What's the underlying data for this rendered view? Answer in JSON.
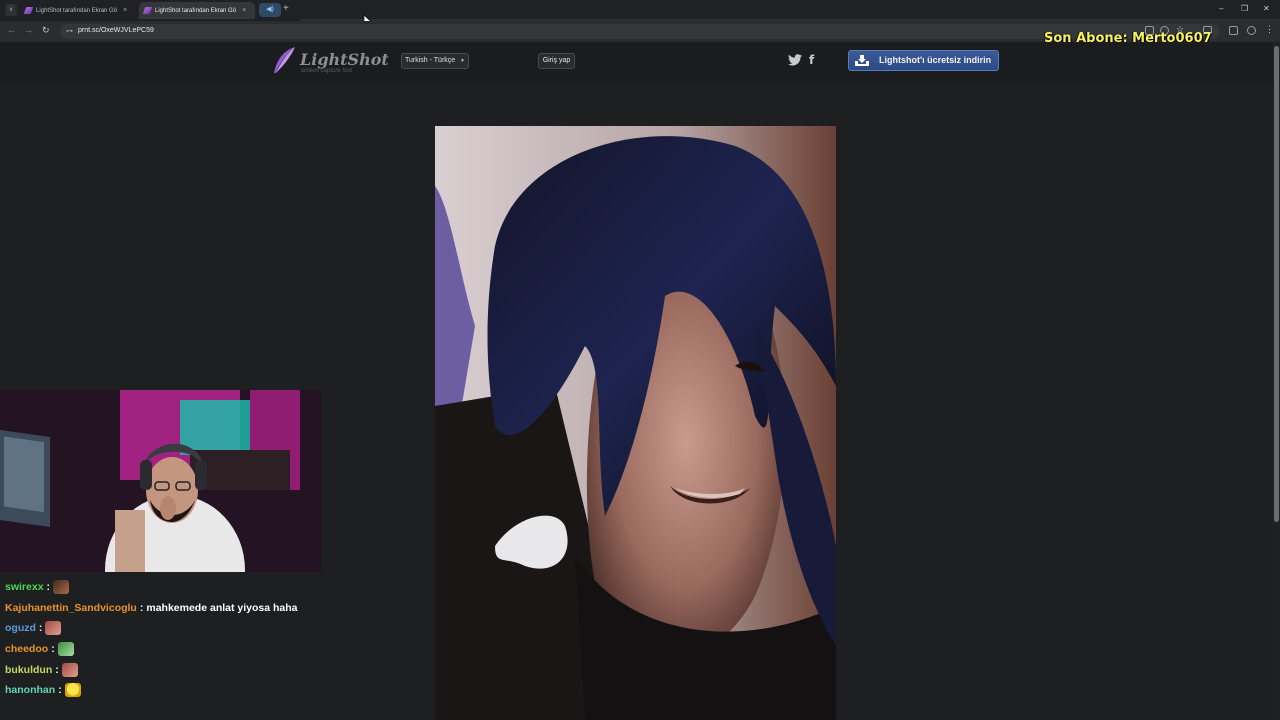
{
  "browser": {
    "tabs": [
      {
        "title": "LightShot tarafından Ekran Gö",
        "active": false
      },
      {
        "title": "LightShot tarafından Ekran Gö",
        "active": true
      }
    ],
    "tab_dropdown_icon": "v",
    "audio_tab_icon": "◀)",
    "new_tab_icon": "+",
    "close_icon": "×",
    "window_controls": {
      "minimize": "–",
      "restore": "❐",
      "close": "✕"
    },
    "back_icon": "←",
    "forward_icon": "→",
    "reload_icon": "↻",
    "site_info_icon": "⊶",
    "url": "prnt.sc/OxeWJVLePC59"
  },
  "stream_overlay": {
    "last_subscriber": "Son Abone: Merto0607",
    "color": "#f7f25c"
  },
  "lightshot": {
    "logo": "LightShot",
    "tagline": "screen capture tool",
    "language": "Turkish - Türkçe",
    "language_arrow": "▼",
    "login": "Giriş yap",
    "download": "Lightshot'ı ücretsiz indirin",
    "accent": "#2c4a86"
  },
  "chat": [
    {
      "user": "swirexx",
      "color": "#4dd84d",
      "text": "",
      "emote": "emote-dark"
    },
    {
      "user": "Kajuhanettin_Sandvicoglu",
      "color": "#e8922a",
      "text": "mahkemede anlat yiyosa haha",
      "emote": ""
    },
    {
      "user": "oguzd",
      "color": "#5b9bd9",
      "text": "",
      "emote": "emote-face"
    },
    {
      "user": "cheedoo",
      "color": "#e8922a",
      "text": "",
      "emote": "emote-green"
    },
    {
      "user": "bukuldun",
      "color": "#c8d85a",
      "text": "",
      "emote": "emote-face"
    },
    {
      "user": "hanonhan",
      "color": "#5ed6b9",
      "text": "",
      "emote": "emote-yellow"
    }
  ]
}
